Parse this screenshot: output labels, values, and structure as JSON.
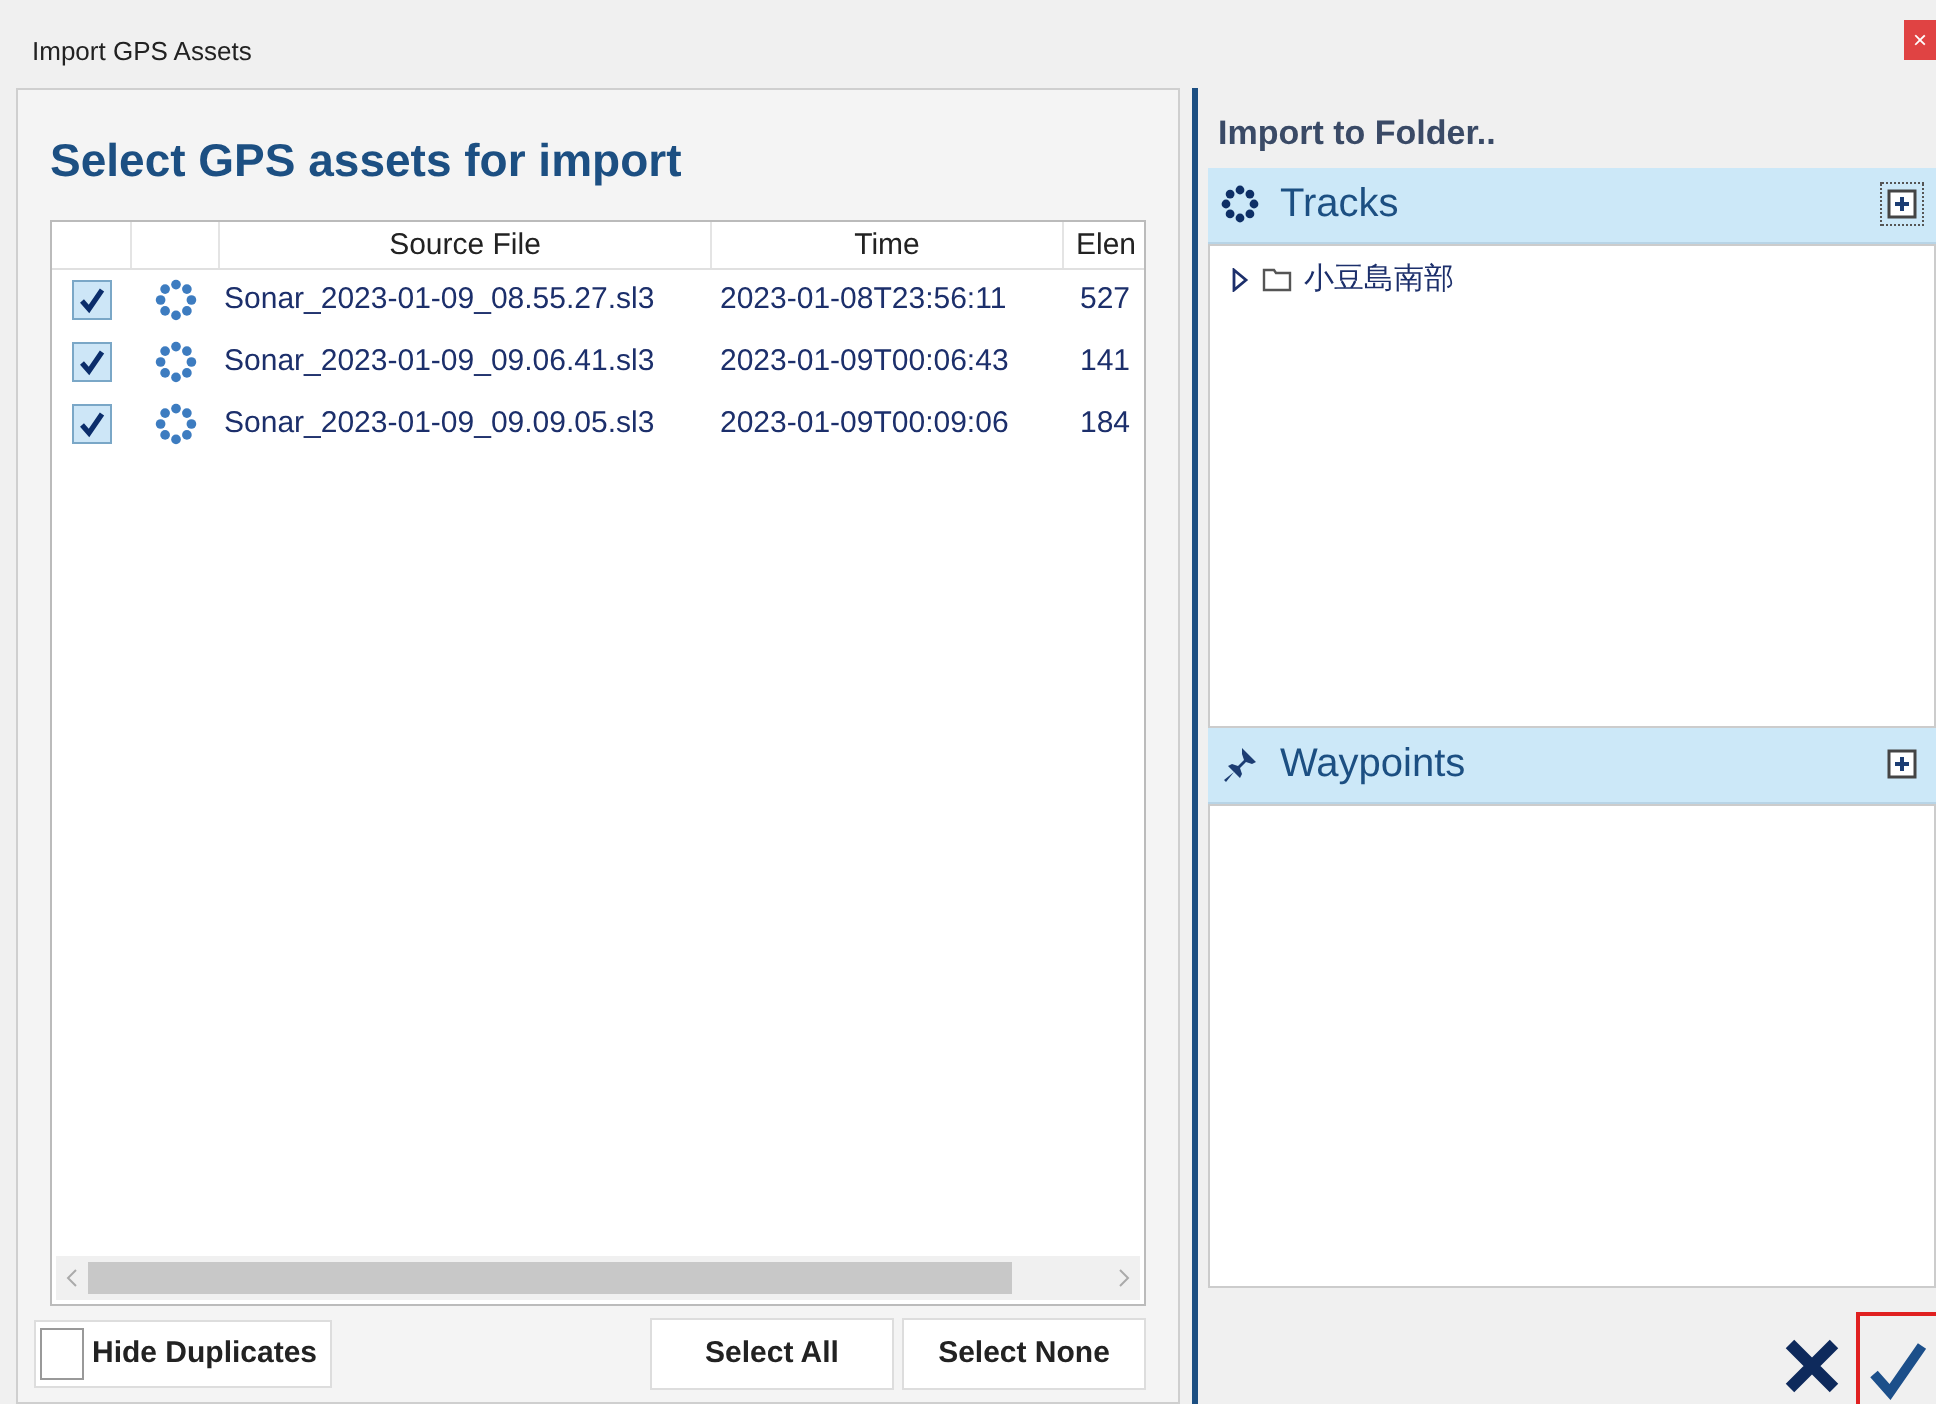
{
  "window": {
    "title": "Import GPS Assets",
    "close": "×"
  },
  "left": {
    "heading": "Select GPS assets for import",
    "columns": [
      "Source File",
      "Time",
      "Elen"
    ],
    "rows": [
      {
        "checked": true,
        "file": "Sonar_2023-01-09_08.55.27.sl3",
        "time": "2023-01-08T23:56:11",
        "column_3": "527"
      },
      {
        "checked": true,
        "file": "Sonar_2023-01-09_09.06.41.sl3",
        "time": "2023-01-09T00:06:43",
        "column_3": "141"
      },
      {
        "checked": true,
        "file": "Sonar_2023-01-09_09.09.05.sl3",
        "time": "2023-01-09T00:09:06",
        "column_3": "184"
      }
    ],
    "hide_duplicates": {
      "label": "Hide Duplicates",
      "checked": false
    },
    "buttons": [
      "Select All",
      "Select None"
    ]
  },
  "right": {
    "heading": "Import to Folder..",
    "sections": [
      {
        "kind": "tracks",
        "title": "Tracks",
        "focused": true,
        "children": [
          {
            "label": "小豆島南部",
            "expanded": false
          }
        ]
      },
      {
        "kind": "waypoints",
        "title": "Waypoints",
        "focused": false
      }
    ],
    "actions": [
      {
        "kind": "cancel",
        "selected": false
      },
      {
        "kind": "ok",
        "selected": true
      }
    ]
  }
}
